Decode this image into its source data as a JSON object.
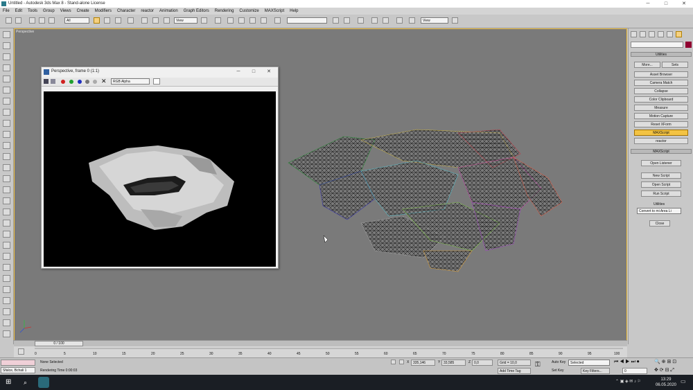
{
  "window": {
    "title": "Untitled - Autodesk 3ds Max 8 - Stand-alone License",
    "minimize": "─",
    "maximize": "□",
    "close": "✕"
  },
  "menu": [
    "File",
    "Edit",
    "Tools",
    "Group",
    "Views",
    "Create",
    "Modifiers",
    "Character",
    "reactor",
    "Animation",
    "Graph Editors",
    "Rendering",
    "Customize",
    "MAXScript",
    "Help"
  ],
  "toolbar": {
    "selection_filter": "All",
    "ref_coord": "View",
    "named_sel": "",
    "view2": "View"
  },
  "viewport": {
    "label": "Perspective"
  },
  "frame_window": {
    "title": "Perspective, frame 0 (1:1)",
    "channel": "RGB Alpha",
    "minimize": "─",
    "maximize": "□",
    "close": "✕"
  },
  "command_panel": {
    "rollout_utilities": "Utilities",
    "more": "More...",
    "sets": "Sets",
    "buttons": [
      "Asset Browser",
      "Camera Match",
      "Collapse",
      "Color Clipboard",
      "Measure",
      "Motion Capture",
      "Reset XForm",
      "MAXScript",
      "reactor"
    ],
    "active_button": "MAXScript",
    "rollout_maxscript": "MAXScript",
    "maxscript_buttons": [
      "Open Listener",
      "New Script",
      "Open Script",
      "Run Script"
    ],
    "utilities_label": "Utilities",
    "utility_select": "Convert to mi Area Li",
    "close": "Close"
  },
  "timeline": {
    "frame": "0 / 100",
    "ticks": [
      "0",
      "5",
      "10",
      "15",
      "20",
      "25",
      "30",
      "35",
      "40",
      "45",
      "50",
      "55",
      "60",
      "65",
      "70",
      "75",
      "80",
      "85",
      "90",
      "95",
      "100"
    ]
  },
  "status": {
    "selection": "None Selected",
    "prompt": "Rendering Time  0:00:03",
    "x_label": "X",
    "x_value": "335,146",
    "y_label": "Y",
    "y_value": "33,585",
    "z_label": "Z",
    "z_value": "0,0",
    "grid": "Grid = 10,0",
    "add_time_tag": "Add Time Tag",
    "auto_key": "Auto Key",
    "key_mode": "Selected",
    "set_key": "Set Key",
    "key_filters": "Key Filters...",
    "frame_field": "0",
    "maxscript_mini": "Sfalce, Bchali  1"
  },
  "taskbar": {
    "time": "13:29",
    "date": "06.05.2020"
  },
  "colors": {
    "viewport": "#7a7a7a",
    "accent": "#f3c343",
    "ui": "#c8c8c8"
  }
}
